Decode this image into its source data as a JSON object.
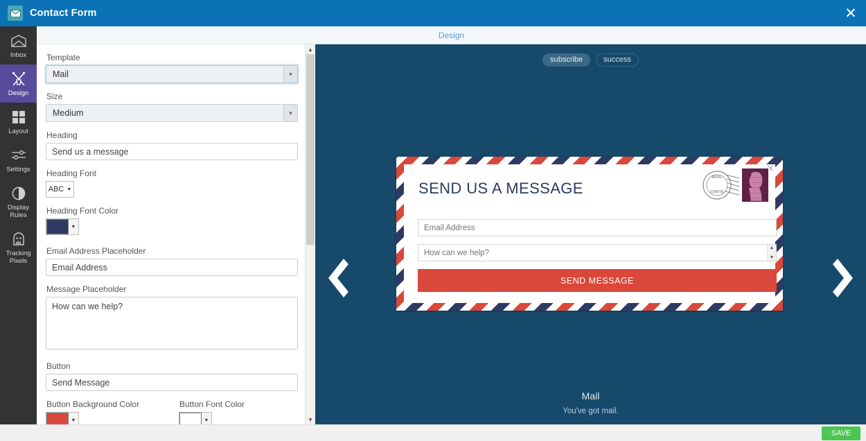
{
  "titlebar": {
    "title": "Contact Form",
    "app_icon": "envelope-icon",
    "close_label": "✕"
  },
  "sidebar": {
    "items": [
      {
        "label": "Inbox",
        "icon": "inbox-envelope-icon",
        "active": false
      },
      {
        "label": "Design",
        "icon": "design-brushes-icon",
        "active": true
      },
      {
        "label": "Layout",
        "icon": "layout-grid-icon",
        "active": false
      },
      {
        "label": "Settings",
        "icon": "sliders-icon",
        "active": false
      },
      {
        "label": "Display\nRules",
        "icon": "contrast-circle-icon",
        "active": false
      },
      {
        "label": "Tracking\nPixels",
        "icon": "tracking-pixel-icon",
        "active": false
      }
    ]
  },
  "preview_tab": {
    "label": "Design"
  },
  "form": {
    "template": {
      "label": "Template",
      "value": "Mail"
    },
    "size": {
      "label": "Size",
      "value": "Medium"
    },
    "heading": {
      "label": "Heading",
      "value": "Send us a message"
    },
    "heading_font": {
      "label": "Heading Font",
      "value": "ABC"
    },
    "heading_font_color": {
      "label": "Heading Font Color",
      "value": "#2f3a63"
    },
    "email_placeholder": {
      "label": "Email Address Placeholder",
      "value": "Email Address"
    },
    "message_placeholder": {
      "label": "Message Placeholder",
      "value": "How can we help?"
    },
    "button": {
      "label": "Button",
      "value": "Send Message"
    },
    "button_bg_color": {
      "label": "Button Background Color",
      "value": "#d9483b"
    },
    "button_font_color": {
      "label": "Button Font Color",
      "value": "#ffffff"
    },
    "caret": "▼"
  },
  "preview": {
    "pills": [
      {
        "label": "subscribe",
        "active": true
      },
      {
        "label": "success",
        "active": false
      }
    ],
    "prev_arrow": "chevron-left-icon",
    "next_arrow": "chevron-right-icon",
    "card": {
      "heading": "SEND US A MESSAGE",
      "close": "✕",
      "email_placeholder": "Email Address",
      "message_placeholder": "How can we help?",
      "button_label": "SEND MESSAGE",
      "postmark_text": "SUMO MAIL"
    },
    "caption": {
      "title": "Mail",
      "subtitle": "You've got mail."
    }
  },
  "bottombar": {
    "save_label": "SAVE"
  },
  "colors": {
    "titlebar": "#0b72b5",
    "rail": "#333333",
    "rail_active": "#574b9c",
    "preview_bg": "#17496b",
    "accent_red": "#d9483b",
    "accent_navy": "#2f3a63",
    "save_green": "#4cc552"
  }
}
